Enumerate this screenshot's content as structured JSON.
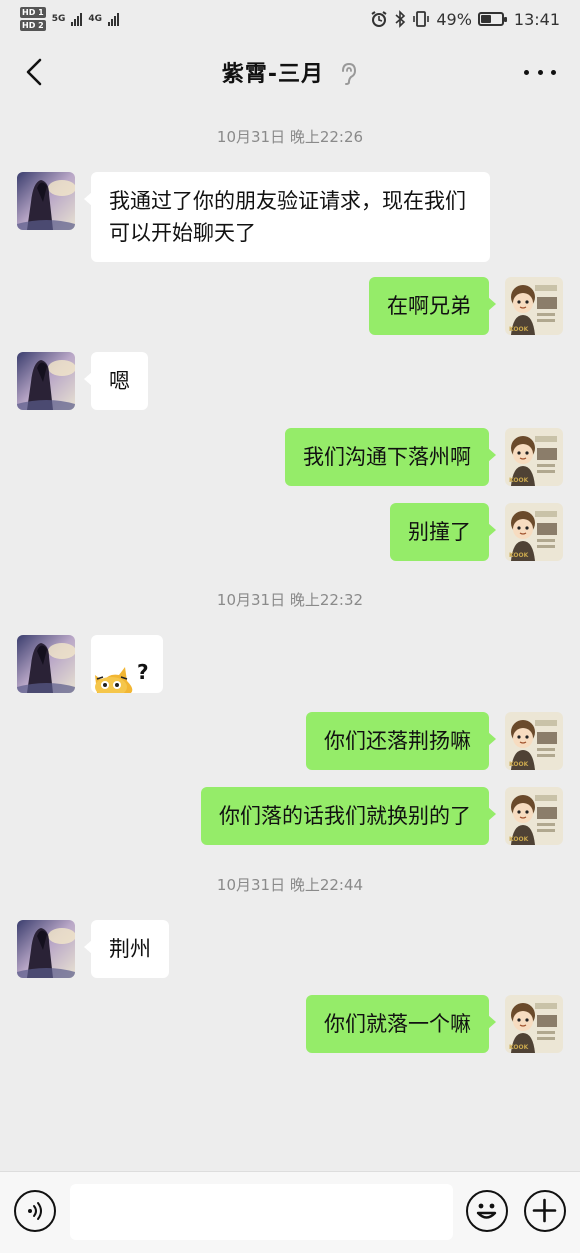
{
  "status_bar": {
    "hd1": "HD 1",
    "hd2": "HD 2",
    "net1": "5G",
    "net2": "4G",
    "battery_text": "49%",
    "battery_level": 0.49,
    "time": "13:41"
  },
  "header": {
    "title": "紫霄-三月"
  },
  "timestamps": {
    "t1": "10月31日 晚上22:26",
    "t2": "10月31日 晚上22:32",
    "t3": "10月31日 晚上22:44"
  },
  "messages": [
    {
      "sender": "them",
      "text": "我通过了你的朋友验证请求，现在我们可以开始聊天了"
    },
    {
      "sender": "me",
      "text": "在啊兄弟"
    },
    {
      "sender": "them",
      "text": "嗯"
    },
    {
      "sender": "me",
      "text": "我们沟通下落州啊"
    },
    {
      "sender": "me",
      "text": "别撞了"
    },
    {
      "sender": "them",
      "text": "?",
      "type": "sticker"
    },
    {
      "sender": "me",
      "text": "你们还落荆扬嘛"
    },
    {
      "sender": "me",
      "text": "你们落的话我们就换别的了"
    },
    {
      "sender": "them",
      "text": "荆州"
    },
    {
      "sender": "me",
      "text": "你们就落一个嘛"
    }
  ],
  "avatar_label": "KOOK",
  "colors": {
    "self_bubble": "#95ec69",
    "other_bubble": "#ffffff",
    "background": "#ededed"
  }
}
